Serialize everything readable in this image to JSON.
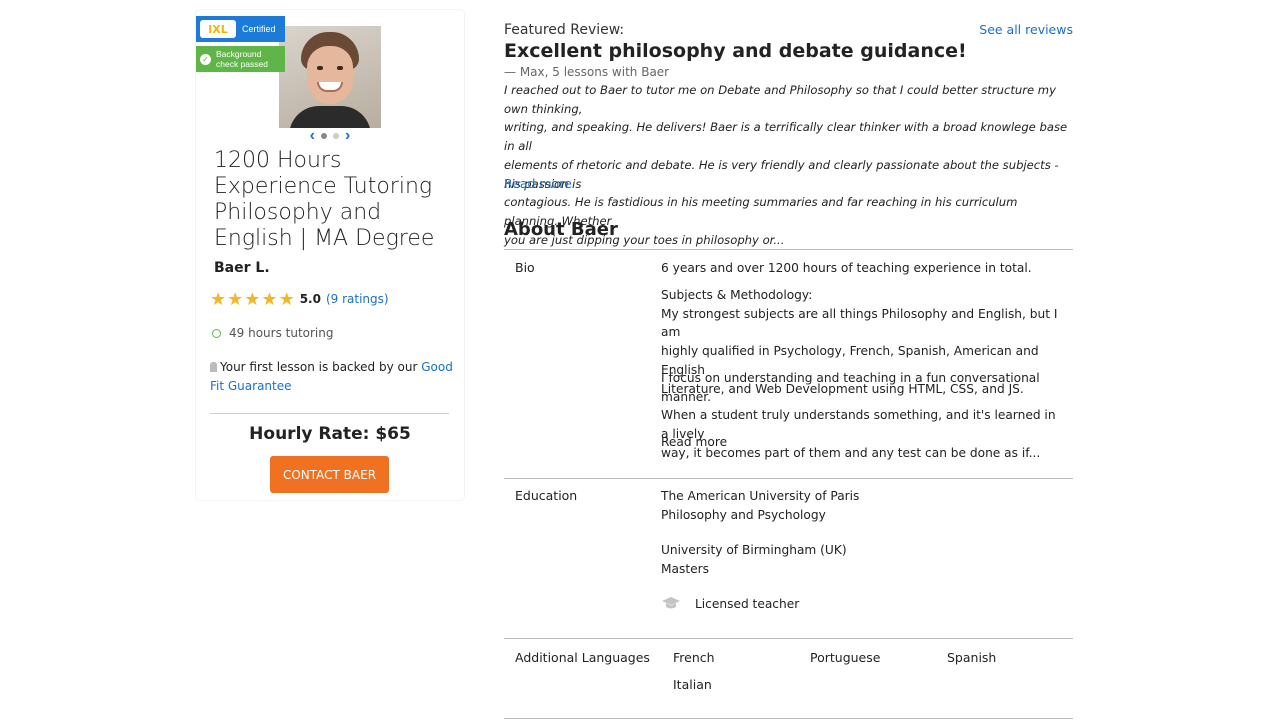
{
  "profile": {
    "badge_brand": "IXL",
    "badge_certified": "Certified",
    "background_check": "Background check passed",
    "title": "1200 Hours Experience Tutoring Philosophy and English | MA Degree",
    "name": "Baer L.",
    "rating": "5.0",
    "ratings_count": "(9 ratings)",
    "stars": 5,
    "hours_tutoring": "49 hours tutoring",
    "guarantee_prefix": "Your first lesson is backed by our",
    "guarantee_link": "Good Fit Guarantee",
    "hourly_rate": "Hourly Rate: $65",
    "contact_button": "CONTACT BAER",
    "carousel_active_index": 1,
    "carousel_count": 2
  },
  "review": {
    "label": "Featured Review:",
    "see_all": "See all reviews",
    "title": "Excellent philosophy and debate guidance!",
    "author": "— Max, 5 lessons with Baer",
    "body_lines": [
      "I reached out to Baer to tutor me on Debate and Philosophy so that I could better structure my own thinking,",
      "writing, and speaking. He delivers! Baer is a terrifically clear thinker with a broad knowlege base in all",
      "elements of rhetoric and debate. He is very friendly and clearly passionate about the subjects - his passion is",
      "contagious. He is fastidious in his meeting summaries and far reaching in his curriculum planning. Whether",
      "you are just dipping your toes in philosophy or..."
    ],
    "read_more": "Read more"
  },
  "about": {
    "title": "About Baer",
    "bio": {
      "label": "Bio",
      "intro": "6 years and over 1200 hours of teaching experience in total.",
      "subjects_heading": "Subjects & Methodology:",
      "subjects_lines": [
        "My strongest subjects are all things Philosophy and English, but I am",
        "highly qualified in Psychology, French, Spanish, American and English",
        "Literature, and Web Development using HTML, CSS, and JS."
      ],
      "method_lines": [
        "I focus on understanding and teaching in a fun conversational manner.",
        "When a student truly understands something, and it's learned in a lively",
        "way, it becomes part of them and any test can be done as if..."
      ],
      "read_more": "Read more"
    },
    "education": {
      "label": "Education",
      "school1": "The American University of Paris",
      "degree1": "Philosophy and Psychology",
      "school2": "University of Birmingham (UK)",
      "degree2": "Masters",
      "licensed": "Licensed teacher"
    },
    "languages": {
      "label": "Additional Languages",
      "items": [
        "French",
        "Portuguese",
        "Spanish",
        "Italian"
      ]
    }
  },
  "colors": {
    "accent_blue": "#1a6fc9",
    "ixl_blue": "#1c7ad9",
    "check_green": "#5fb548",
    "contact_orange": "#f07122",
    "star_gold": "#f5b626"
  }
}
